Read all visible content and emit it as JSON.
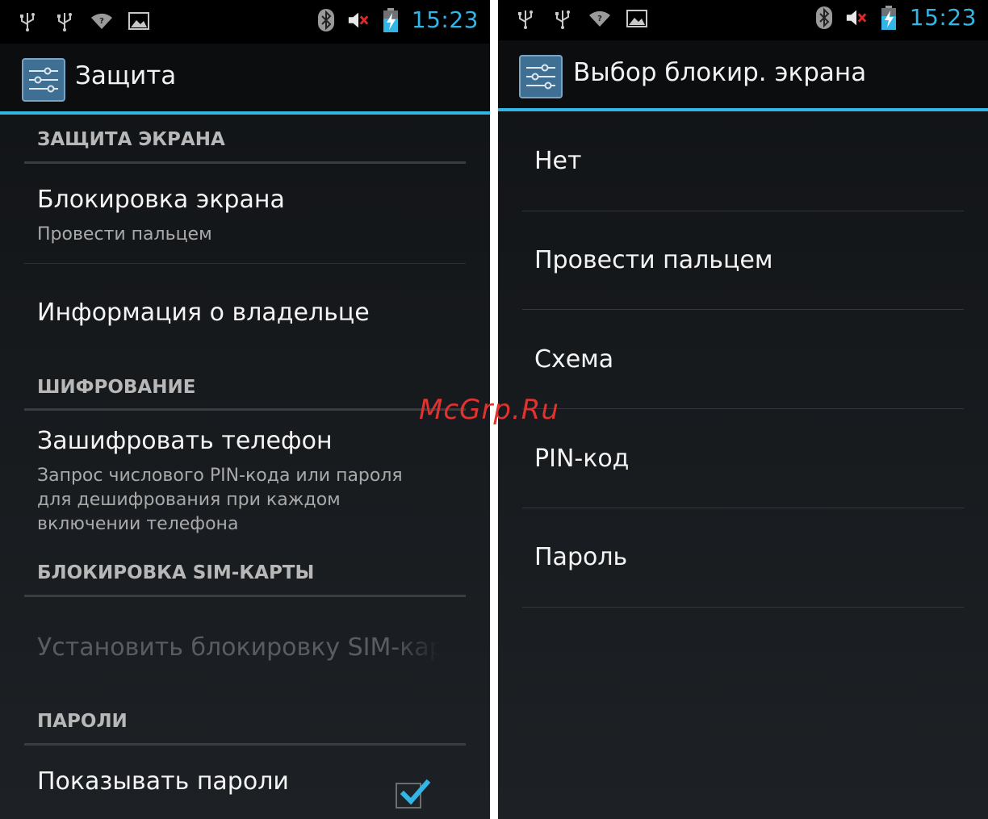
{
  "colors": {
    "accent": "#33b5e5",
    "watermark": "#e0322e",
    "checkmark": "#33b5e5"
  },
  "left": {
    "status": {
      "icons": [
        "usb-icon",
        "usb-icon",
        "wifi-icon",
        "image-icon"
      ],
      "right_icons": [
        "bluetooth-icon",
        "mute-icon",
        "battery-charging-icon"
      ],
      "time": "15:23"
    },
    "action_bar": {
      "icon": "settings-sliders-icon",
      "title": "Защита"
    },
    "sections": {
      "screen_security": "ЗАЩИТА ЭКРАНА",
      "encryption": "ШИФРОВАНИЕ",
      "sim_lock": "БЛОКИРОВКА SIM-КАРТЫ",
      "passwords": "ПАРОЛИ"
    },
    "items": {
      "screen_lock": {
        "title": "Блокировка экрана",
        "summary": "Провести пальцем"
      },
      "owner_info": {
        "title": "Информация о владельце"
      },
      "encrypt_phone": {
        "title": "Зашифровать телефон",
        "summary": "Запрос числового PIN-кода или пароля для дешифрования при каждом включении телефона"
      },
      "sim_lock": {
        "title": "Установить блокировку SIM-карты"
      },
      "show_passwords": {
        "title": "Показывать пароли",
        "checked": true
      }
    }
  },
  "right": {
    "status": {
      "icons": [
        "usb-icon",
        "usb-icon",
        "wifi-icon",
        "image-icon"
      ],
      "right_icons": [
        "bluetooth-icon",
        "mute-icon",
        "battery-charging-icon"
      ],
      "time": "15:23"
    },
    "action_bar": {
      "icon": "settings-sliders-icon",
      "title": "Выбор блокир. экрана"
    },
    "options": [
      "Нет",
      "Провести пальцем",
      "Схема",
      "PIN-код",
      "Пароль"
    ]
  },
  "watermark": "McGrp.Ru"
}
